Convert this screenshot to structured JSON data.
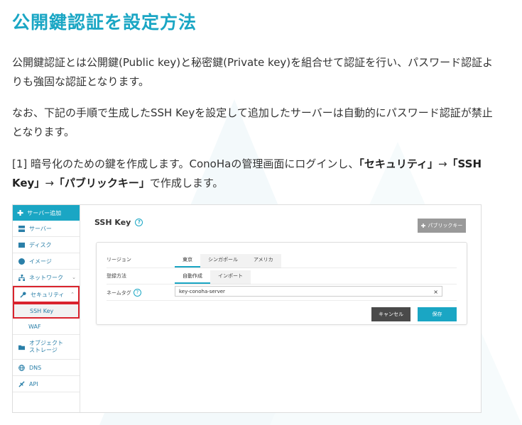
{
  "article": {
    "heading": "公開鍵認証を設定方法",
    "para1": "公開鍵認証とは公開鍵(Public key)と秘密鍵(Private key)を組合せて認証を行い、パスワード認証よりも強固な認証となります。",
    "para2": "なお、下記の手順で生成したSSH Keyを設定して追加したサーバーは自動的にパスワード認証が禁止となります。",
    "para3_pre": "[1] 暗号化のための鍵を作成します。ConoHaの管理画面にログインし、",
    "para3_b1": "「セキュリティ」",
    "para3_arrow1": "→",
    "para3_b2": "「SSH Key」",
    "para3_arrow2": "→",
    "para3_b3": "「パブリックキー」",
    "para3_post": "で作成します。"
  },
  "sidebar": {
    "add_server": "サーバー追加",
    "items": [
      {
        "label": "サーバー",
        "icon": "server-icon"
      },
      {
        "label": "ディスク",
        "icon": "disk-icon"
      },
      {
        "label": "イメージ",
        "icon": "image-icon"
      },
      {
        "label": "ネットワーク",
        "icon": "network-icon"
      },
      {
        "label": "セキュリティ",
        "icon": "key-icon"
      },
      {
        "label": "SSH Key"
      },
      {
        "label": "WAF"
      },
      {
        "label": "オブジェクト\nストレージ",
        "icon": "folder-icon"
      },
      {
        "label": "DNS",
        "icon": "globe-icon"
      },
      {
        "label": "API",
        "icon": "api-icon"
      }
    ]
  },
  "panel": {
    "title": "SSH Key",
    "add_button": "パブリックキー",
    "region_label": "リージョン",
    "regions": [
      "東京",
      "シンガポール",
      "アメリカ"
    ],
    "method_label": "登録方法",
    "methods": [
      "自動作成",
      "インポート"
    ],
    "nametag_label": "ネームタグ",
    "nametag_value": "key-conoha-server",
    "cancel": "キャンセル",
    "save": "保存"
  },
  "colors": {
    "accent": "#1aa6c4",
    "highlight_border": "#d9232d"
  }
}
